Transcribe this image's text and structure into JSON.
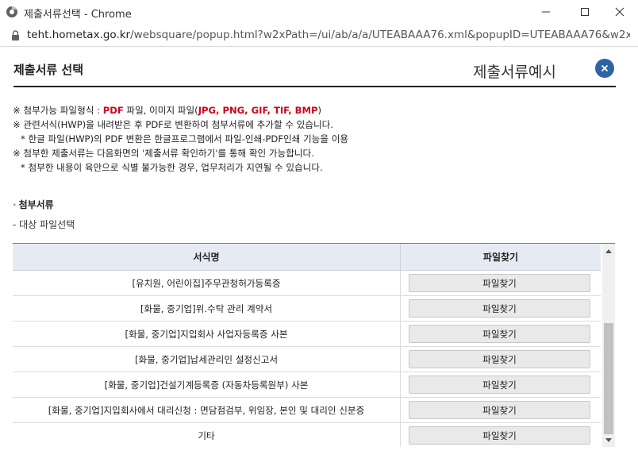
{
  "window": {
    "title": "제출서류선택 - Chrome",
    "url_host": "teht.hometax.go.kr",
    "url_path": "/websquare/popup.html?w2xPath=/ui/ab/a/a/UTEABAAA76.xml&popupID=UTEABAAA76&w2xHo..."
  },
  "popup": {
    "title": "제출서류 선택",
    "example_link": "제출서류예시",
    "notes": {
      "line1_prefix": "※ 첨부가능 파일형식 : ",
      "line1_pdf": "PDF",
      "line1_mid": " 파일, 이미지 파일(",
      "line1_types": "JPG, PNG, GIF, TIF, BMP",
      "line1_suffix": ")",
      "line2": "※ 관련서식(HWP)을 내려받은 후 PDF로 변환하여 첨부서류에 추가할 수 있습니다.",
      "line3": "* 한글 파일(HWP)의 PDF 변환은 한글프로그램에서 파일-인쇄-PDF인쇄 기능을 이용",
      "line4": "※ 첨부한 제출서류는 다음화면의 '제출서류 확인하기'를 통해 확인 가능합니다.",
      "line5": "* 첨부한 내용이 육안으로 식별 불가능한 경우, 업무처리가 지연될 수 있습니다."
    },
    "section_title": "첨부서류",
    "sub_label": "- 대상 파일선택"
  },
  "grid": {
    "headers": [
      "서식명",
      "파일찾기"
    ],
    "rows": [
      {
        "name": "[유치원, 어린이집]주무관청허가등록증",
        "button": "파일찾기"
      },
      {
        "name": "[화물, 중기업]위.수탁 관리 계약서",
        "button": "파일찾기"
      },
      {
        "name": "[화물, 중기업]지입회사 사업자등록증 사본",
        "button": "파일찾기"
      },
      {
        "name": "[화물, 중기업]납세관리인 설정신고서",
        "button": "파일찾기"
      },
      {
        "name": "[화물, 중기업]건설기계등록증 (자동차등록원부) 사본",
        "button": "파일찾기"
      },
      {
        "name": "[화물, 중기업]지입회사에서 대리신청 : 면담점검부, 위임장, 본인 및 대리인 신분증",
        "button": "파일찾기"
      },
      {
        "name": "기타",
        "button": "파일찾기"
      }
    ]
  },
  "icons": {
    "app": "chrome-globe-icon",
    "lock": "lock-icon",
    "close": "close-icon"
  },
  "colors": {
    "accent_red": "#d0021b",
    "close_button": "#2e63a6",
    "header_bg": "#e6ebf3",
    "section_dot": "#e87722"
  }
}
